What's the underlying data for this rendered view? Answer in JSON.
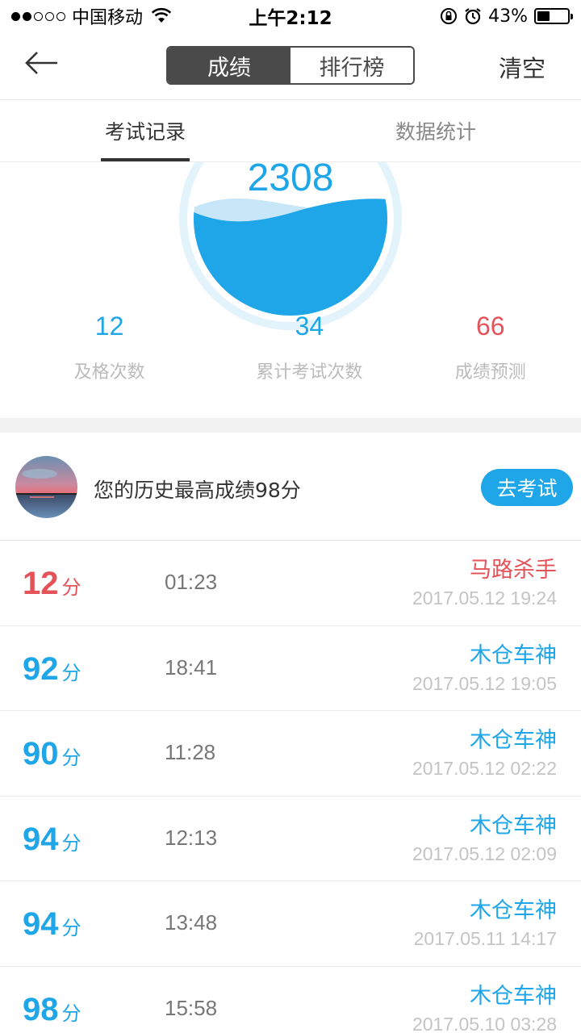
{
  "status_bar": {
    "carrier": "中国移动",
    "time": "上午2:12",
    "battery_percent": "43%",
    "battery_level": 0.43,
    "wifi_icon": "wifi-icon",
    "lock_icon": "rotation-lock-icon",
    "alarm_icon": "alarm-icon"
  },
  "nav": {
    "back_icon": "back-arrow-icon",
    "segments": [
      "成绩",
      "排行榜"
    ],
    "active_segment": 0,
    "clear_label": "清空"
  },
  "tabs": [
    {
      "label": "考试记录",
      "active": true
    },
    {
      "label": "数据统计",
      "active": false
    }
  ],
  "summary": {
    "total_score": "2308",
    "stats": [
      {
        "value": "12",
        "label": "及格次数",
        "color": "#1ea6e8"
      },
      {
        "value": "34",
        "label": "累计考试次数",
        "color": "#1ea6e8"
      },
      {
        "value": "66",
        "label": "成绩预测",
        "color": "#e5535a"
      }
    ]
  },
  "best": {
    "text": "您的历史最高成绩98分",
    "button_label": "去考试"
  },
  "records": [
    {
      "score": "12",
      "unit": "分",
      "duration": "01:23",
      "rank": "马路杀手",
      "datetime": "2017.05.12 19:24",
      "color": "#e5535a"
    },
    {
      "score": "92",
      "unit": "分",
      "duration": "18:41",
      "rank": "木仓车神",
      "datetime": "2017.05.12 19:05",
      "color": "#1ea6e8"
    },
    {
      "score": "90",
      "unit": "分",
      "duration": "11:28",
      "rank": "木仓车神",
      "datetime": "2017.05.12 02:22",
      "color": "#1ea6e8"
    },
    {
      "score": "94",
      "unit": "分",
      "duration": "12:13",
      "rank": "木仓车神",
      "datetime": "2017.05.12 02:09",
      "color": "#1ea6e8"
    },
    {
      "score": "94",
      "unit": "分",
      "duration": "13:48",
      "rank": "木仓车神",
      "datetime": "2017.05.11 14:17",
      "color": "#1ea6e8"
    },
    {
      "score": "98",
      "unit": "分",
      "duration": "15:58",
      "rank": "木仓车神",
      "datetime": "2017.05.10 03:28",
      "color": "#1ea6e8"
    }
  ]
}
